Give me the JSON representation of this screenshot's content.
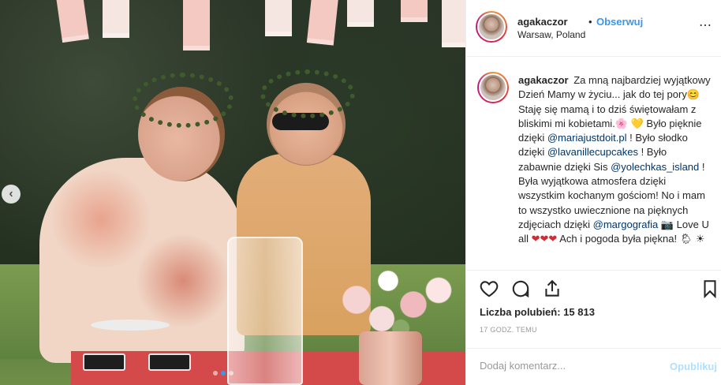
{
  "post": {
    "username": "agakaczor",
    "separator": "•",
    "follow_label": "Obserwuj",
    "location": "Warsaw, Poland",
    "more_label": "⋯"
  },
  "caption": {
    "username": "agakaczor",
    "parts": {
      "p1": "Za mną najbardziej wyjątkowy Dzień Mamy w życiu... jak do tej pory",
      "e1": "😊",
      "p2": " Staję się mamą i to dziś świętowałam z bliskimi mi kobietami.",
      "e2": "🌸",
      "e3": "💛",
      "p3": " Było pięknie dzięki ",
      "m1": "@mariajustdoit.pl",
      "p4": " ! Było słodko dzięki ",
      "m2": "@lavanillecupcakes",
      "p5": " ! Było zabawnie dzięki Sis ",
      "m3": "@yolechkas_island",
      "p6": " ! Była wyjątkowa atmosfera dzięki wszystkim kochanym gościom! No i mam to wszystko uwiecznione na pięknych zdjęciach dzięki ",
      "m4": "@margografia",
      "e4": " 📷",
      "p7": " Love U all ",
      "e5": "❤❤❤",
      "p8": " Ach i pogoda była piękna!",
      "e6": "🌦 ☀"
    }
  },
  "carousel": {
    "prev_label": "‹",
    "slide_count": 3,
    "active_slide": 1
  },
  "stats": {
    "likes_text": "Liczba polubień: 15 813",
    "time_text": "17 GODZ. TEMU"
  },
  "comment": {
    "placeholder": "Dodaj komentarz...",
    "publish_label": "Opublikuj"
  },
  "colors": {
    "accent": "#3897f0",
    "mention": "#003569",
    "publish_disabled": "#b2dffc",
    "border": "#efefef"
  },
  "icons": {
    "like": "heart-outline-icon",
    "comment": "speech-bubble-icon",
    "share": "share-icon",
    "save": "bookmark-icon",
    "prev": "chevron-left-icon"
  }
}
